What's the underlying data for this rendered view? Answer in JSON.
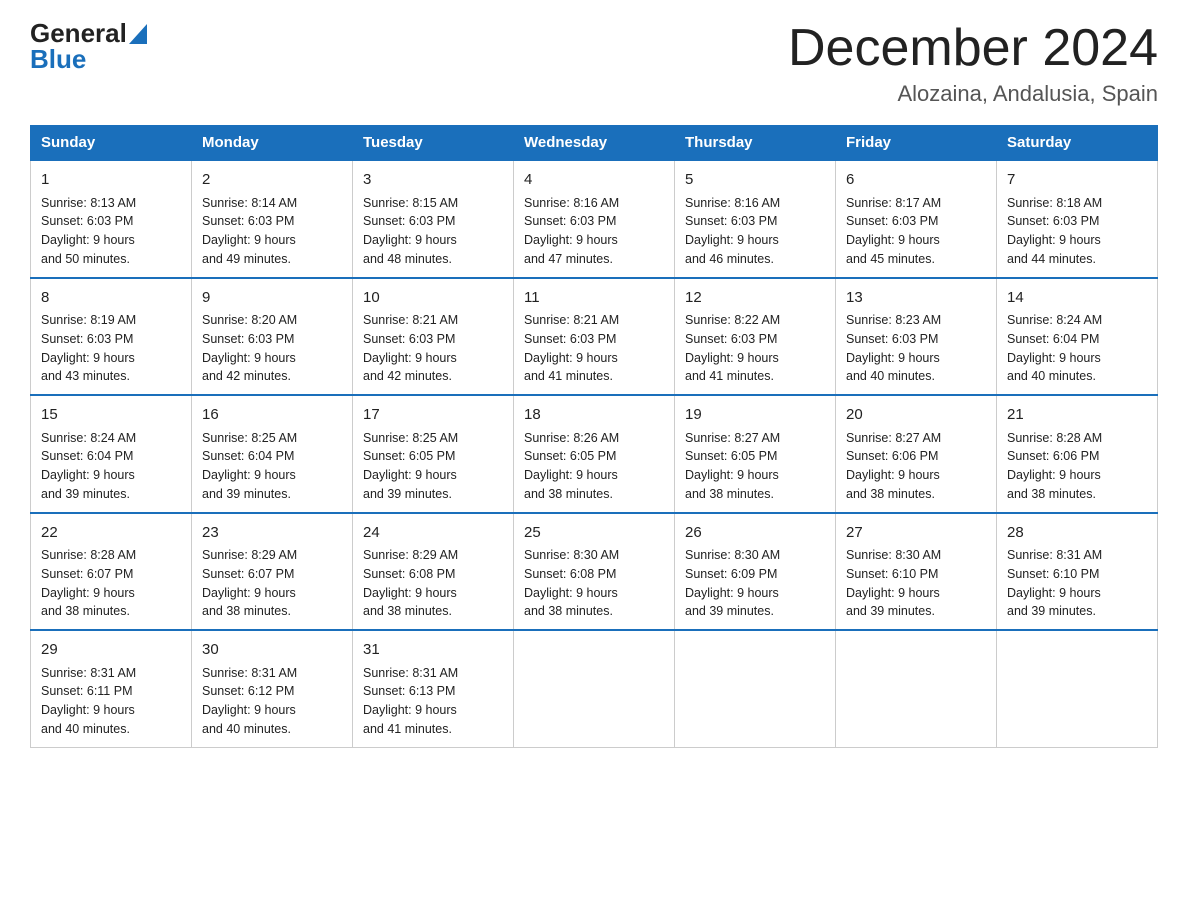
{
  "logo": {
    "general": "General",
    "blue": "Blue"
  },
  "header": {
    "month": "December 2024",
    "location": "Alozaina, Andalusia, Spain"
  },
  "days_of_week": [
    "Sunday",
    "Monday",
    "Tuesday",
    "Wednesday",
    "Thursday",
    "Friday",
    "Saturday"
  ],
  "weeks": [
    [
      {
        "day": "1",
        "sunrise": "8:13 AM",
        "sunset": "6:03 PM",
        "daylight": "9 hours and 50 minutes."
      },
      {
        "day": "2",
        "sunrise": "8:14 AM",
        "sunset": "6:03 PM",
        "daylight": "9 hours and 49 minutes."
      },
      {
        "day": "3",
        "sunrise": "8:15 AM",
        "sunset": "6:03 PM",
        "daylight": "9 hours and 48 minutes."
      },
      {
        "day": "4",
        "sunrise": "8:16 AM",
        "sunset": "6:03 PM",
        "daylight": "9 hours and 47 minutes."
      },
      {
        "day": "5",
        "sunrise": "8:16 AM",
        "sunset": "6:03 PM",
        "daylight": "9 hours and 46 minutes."
      },
      {
        "day": "6",
        "sunrise": "8:17 AM",
        "sunset": "6:03 PM",
        "daylight": "9 hours and 45 minutes."
      },
      {
        "day": "7",
        "sunrise": "8:18 AM",
        "sunset": "6:03 PM",
        "daylight": "9 hours and 44 minutes."
      }
    ],
    [
      {
        "day": "8",
        "sunrise": "8:19 AM",
        "sunset": "6:03 PM",
        "daylight": "9 hours and 43 minutes."
      },
      {
        "day": "9",
        "sunrise": "8:20 AM",
        "sunset": "6:03 PM",
        "daylight": "9 hours and 42 minutes."
      },
      {
        "day": "10",
        "sunrise": "8:21 AM",
        "sunset": "6:03 PM",
        "daylight": "9 hours and 42 minutes."
      },
      {
        "day": "11",
        "sunrise": "8:21 AM",
        "sunset": "6:03 PM",
        "daylight": "9 hours and 41 minutes."
      },
      {
        "day": "12",
        "sunrise": "8:22 AM",
        "sunset": "6:03 PM",
        "daylight": "9 hours and 41 minutes."
      },
      {
        "day": "13",
        "sunrise": "8:23 AM",
        "sunset": "6:03 PM",
        "daylight": "9 hours and 40 minutes."
      },
      {
        "day": "14",
        "sunrise": "8:24 AM",
        "sunset": "6:04 PM",
        "daylight": "9 hours and 40 minutes."
      }
    ],
    [
      {
        "day": "15",
        "sunrise": "8:24 AM",
        "sunset": "6:04 PM",
        "daylight": "9 hours and 39 minutes."
      },
      {
        "day": "16",
        "sunrise": "8:25 AM",
        "sunset": "6:04 PM",
        "daylight": "9 hours and 39 minutes."
      },
      {
        "day": "17",
        "sunrise": "8:25 AM",
        "sunset": "6:05 PM",
        "daylight": "9 hours and 39 minutes."
      },
      {
        "day": "18",
        "sunrise": "8:26 AM",
        "sunset": "6:05 PM",
        "daylight": "9 hours and 38 minutes."
      },
      {
        "day": "19",
        "sunrise": "8:27 AM",
        "sunset": "6:05 PM",
        "daylight": "9 hours and 38 minutes."
      },
      {
        "day": "20",
        "sunrise": "8:27 AM",
        "sunset": "6:06 PM",
        "daylight": "9 hours and 38 minutes."
      },
      {
        "day": "21",
        "sunrise": "8:28 AM",
        "sunset": "6:06 PM",
        "daylight": "9 hours and 38 minutes."
      }
    ],
    [
      {
        "day": "22",
        "sunrise": "8:28 AM",
        "sunset": "6:07 PM",
        "daylight": "9 hours and 38 minutes."
      },
      {
        "day": "23",
        "sunrise": "8:29 AM",
        "sunset": "6:07 PM",
        "daylight": "9 hours and 38 minutes."
      },
      {
        "day": "24",
        "sunrise": "8:29 AM",
        "sunset": "6:08 PM",
        "daylight": "9 hours and 38 minutes."
      },
      {
        "day": "25",
        "sunrise": "8:30 AM",
        "sunset": "6:08 PM",
        "daylight": "9 hours and 38 minutes."
      },
      {
        "day": "26",
        "sunrise": "8:30 AM",
        "sunset": "6:09 PM",
        "daylight": "9 hours and 39 minutes."
      },
      {
        "day": "27",
        "sunrise": "8:30 AM",
        "sunset": "6:10 PM",
        "daylight": "9 hours and 39 minutes."
      },
      {
        "day": "28",
        "sunrise": "8:31 AM",
        "sunset": "6:10 PM",
        "daylight": "9 hours and 39 minutes."
      }
    ],
    [
      {
        "day": "29",
        "sunrise": "8:31 AM",
        "sunset": "6:11 PM",
        "daylight": "9 hours and 40 minutes."
      },
      {
        "day": "30",
        "sunrise": "8:31 AM",
        "sunset": "6:12 PM",
        "daylight": "9 hours and 40 minutes."
      },
      {
        "day": "31",
        "sunrise": "8:31 AM",
        "sunset": "6:13 PM",
        "daylight": "9 hours and 41 minutes."
      },
      null,
      null,
      null,
      null
    ]
  ],
  "labels": {
    "sunrise": "Sunrise:",
    "sunset": "Sunset:",
    "daylight": "Daylight:"
  }
}
